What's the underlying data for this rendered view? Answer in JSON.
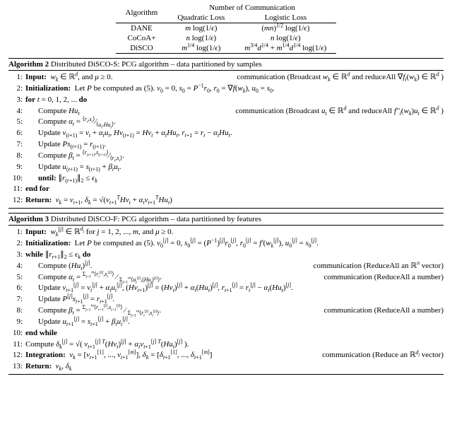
{
  "comparison_table": {
    "header_top": "Number of Communication",
    "col_algorithm": "Algorithm",
    "col_quadratic": "Quadratic Loss",
    "col_logistic": "Logistic Loss",
    "rows": [
      {
        "algo": "DANE",
        "q": "m log(1/ϵ)",
        "l": "(mn)^{1/2} log(1/ϵ)"
      },
      {
        "algo": "CoCoA+",
        "q": "n log(1/ϵ)",
        "l": "n log(1/ϵ)"
      },
      {
        "algo": "DiSCO",
        "q": "m^{1/4} log(1/ϵ)",
        "l": "m^{3/4} d^{1/4} + m^{1/4} d^{1/4} log(1/ϵ)"
      }
    ]
  },
  "algo2": {
    "title": "Algorithm 2 Distributed DiSCO-S: PCG algorithm – data partitioned by samples",
    "steps": [
      {
        "n": "1:",
        "text": "Input:  w_k ∈ ℝ^d, and μ ≥ 0.",
        "comm": "communication (Broadcast w_k ∈ ℝ^d and reduceAll ∇f_i(w_k) ∈ ℝ^d )"
      },
      {
        "n": "2:",
        "text": "Initialization:  Let P be computed as (5). v_0 = 0, s_0 = P^{-1}r_0, r_0 = ∇f(w_k), u_0 = s_0."
      },
      {
        "n": "3:",
        "text": "for t = 0, 1, 2, ... do"
      },
      {
        "n": "4:",
        "text": "Compute Hu_t",
        "ind": 1,
        "comm": "communication (Broadcast u_t ∈ ℝ^d and reduceAll f''_i(w_k)u_t ∈ ℝ^d )"
      },
      {
        "n": "5:",
        "text": "Compute α_t = ⟨r_t, s_t⟩ / ⟨u_t, Hu_t⟩.",
        "ind": 1
      },
      {
        "n": "6:",
        "text": "Update v_{(t+1)} = v_t + α_t u_t, Hv_{(t+1)} = Hv_t + α_t Hu_t, r_{t+1} = r_t − α_t Hu_t.",
        "ind": 1
      },
      {
        "n": "7:",
        "text": "Update Ps_{(t+1)} = r_{(t+1)}.",
        "ind": 1
      },
      {
        "n": "8:",
        "text": "Compute β_t = ⟨r_{(t+1)}, s_{(t+1)}⟩ / ⟨r_t, s_t⟩.",
        "ind": 1
      },
      {
        "n": "9:",
        "text": "Update u_{(t+1)} = s_{(t+1)} + β_t u_t.",
        "ind": 1
      },
      {
        "n": "10:",
        "text": "until: ∥r_{(r+1)}∥_2 ≤ ϵ_k",
        "ind": 1
      },
      {
        "n": "11:",
        "text": "end for"
      },
      {
        "n": "12:",
        "text": "Return:  v_k = v_{t+1}, δ_k = √( v_{t+1}^T H v_t + α_t v_{t+1}^T H u_t )"
      }
    ]
  },
  "algo3": {
    "title": "Algorithm 3 Distributed DiSCO-F: PCG algorithm – data partitioned by features",
    "steps": [
      {
        "n": "1:",
        "text": "Input:  w_k^{[j]} ∈ ℝ^{d_j} for j = 1, 2, ..., m, and μ ≥ 0."
      },
      {
        "n": "2:",
        "text": "Initialization:  Let P be computed as (5). v_0^{[j]} = 0, s_0^{[j]} = (P^{-1})^{[j]} r_0^{[j]}, r_0^{[j]} = f'(w_k^{[j]}), u_0^{[j]} = s_0^{[j]}."
      },
      {
        "n": "3:",
        "text": "while ∥r_{r+1}∥_2 ≤ ϵ_k do"
      },
      {
        "n": "4:",
        "text": "Compute (Hu_t)^{[j]}.",
        "ind": 1,
        "comm": "communication (ReduceAll an ℝ^n vector)"
      },
      {
        "n": "5:",
        "text": "Compute α_t = ( Σ_{j=1}^m ⟨r_t^{[j]}, s_t^{[j]}⟩ ) / ( Σ_{j=1}^m ⟨u_t^{[j]}, (Hu_t)^{[j]}⟩ ).",
        "ind": 1,
        "comm": "communication (ReduceAll a number)"
      },
      {
        "n": "6:",
        "text": "Update v_{t+1}^{[j]} = v_t^{[j]} + α_t u_t^{[j]}, (Hv_{t+1})^{[j]} = (Hv_t)^{[j]} + α_t (Hu_t)^{[j]}, r_{t+1}^{[j]} = r_t^{[j]} − α_t (Hu_t)^{[j]}.",
        "ind": 1
      },
      {
        "n": "7:",
        "text": "Update P^{[j]} s_{t+1}^{[j]} = r_{t+1}^{[j]}.",
        "ind": 1
      },
      {
        "n": "8:",
        "text": "Compute β_t = ( Σ_{j=1}^m ⟨r_{t+1}^{[j]}, s_{t+1}^{[j]}⟩ ) / ( Σ_{j=1}^m ⟨r_t^{[j]}, s_t^{[j]}⟩ ).",
        "ind": 1,
        "comm": "communication (ReduceAll a number)"
      },
      {
        "n": "9:",
        "text": "Update u_{t+1}^{[j]} = s_{t+1}^{[j]} + β_t u_t^{[j]}.",
        "ind": 1
      },
      {
        "n": "10:",
        "text": "end while"
      },
      {
        "n": "11:",
        "text": "Compute δ_k^{[j]} = √( v_{t+1}^{[j] T} (Hv_t)^{[j]} + α_t v_{t+1}^{[j] T} (Hu_t)^{[j]} )."
      },
      {
        "n": "12:",
        "text": "Integration:  v_k = [v_{t+1}^{[1]}, ..., v_{t+1}^{[m]}], δ_k = [δ_{t+1}^{[1]}, ..., δ_{t+1}^{[m]}]",
        "comm": "communication (Reduce an ℝ^{d_j} vector)"
      },
      {
        "n": "13:",
        "text": "Return:  v_k, δ_k"
      }
    ]
  },
  "chart_data": {
    "type": "table",
    "title": "Number of Communication",
    "columns": [
      "Algorithm",
      "Quadratic Loss",
      "Logistic Loss"
    ],
    "rows": [
      [
        "DANE",
        "m log(1/ϵ)",
        "(mn)^{1/2} log(1/ϵ)"
      ],
      [
        "CoCoA+",
        "n log(1/ϵ)",
        "n log(1/ϵ)"
      ],
      [
        "DiSCO",
        "m^{1/4} log(1/ϵ)",
        "m^{3/4} d^{1/4} + m^{1/4} d^{1/4} log(1/ϵ)"
      ]
    ]
  }
}
